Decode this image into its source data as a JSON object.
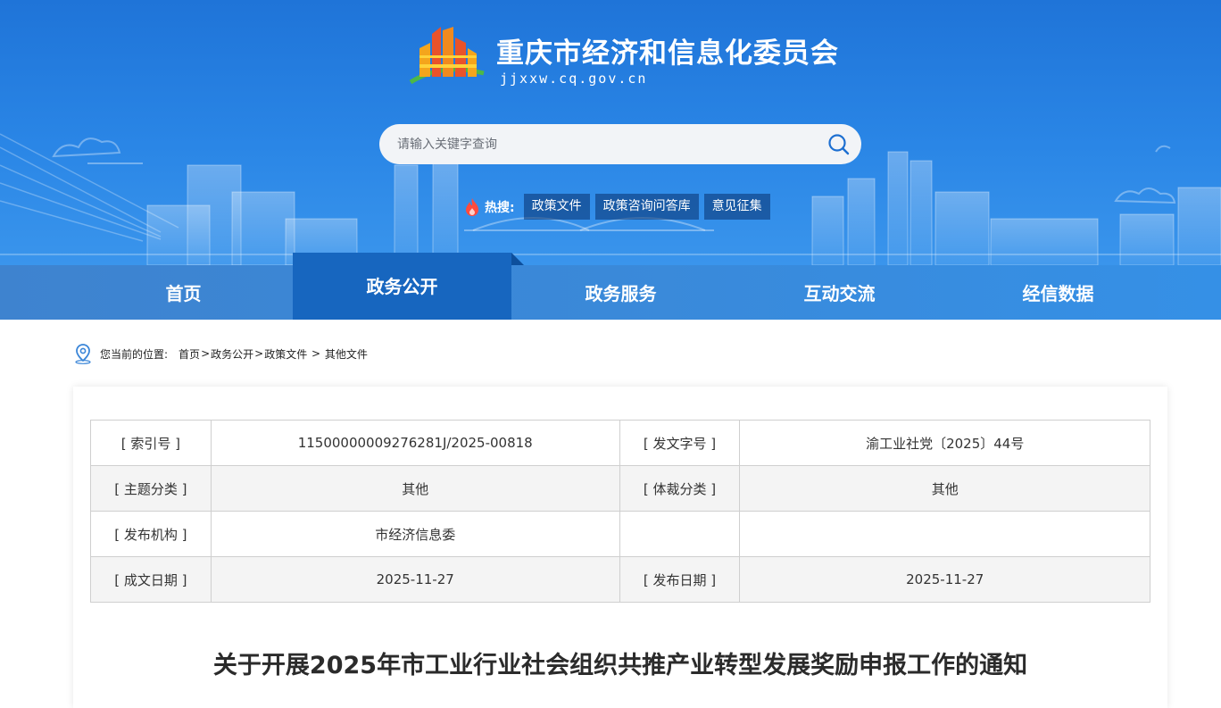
{
  "header": {
    "site_title": "重庆市经济和信息化委员会",
    "site_domain": "jjxxw.cq.gov.cn",
    "search_placeholder": "请输入关键字查询",
    "hot_label": "热搜:",
    "hot_tags": [
      "政策文件",
      "政策咨询问答库",
      "意见征集"
    ]
  },
  "nav": {
    "items": [
      "首页",
      "政务公开",
      "政务服务",
      "互动交流",
      "经信数据"
    ],
    "active": "政务公开"
  },
  "breadcrumb": {
    "prefix": "您当前的位置:",
    "items": [
      "首页",
      "政务公开",
      "政策文件",
      "其他文件"
    ],
    "separators": [
      ">",
      ">",
      " > "
    ]
  },
  "meta_table": {
    "rows": [
      [
        {
          "k": "[ 索引号 ]",
          "v": "11500000009276281J/2025-00818"
        },
        {
          "k": "[ 发文字号 ]",
          "v": "渝工业社党〔2025〕44号"
        }
      ],
      [
        {
          "k": "[ 主题分类 ]",
          "v": "其他"
        },
        {
          "k": "[ 体裁分类 ]",
          "v": "其他"
        }
      ],
      [
        {
          "k": "[ 发布机构 ]",
          "v": "市经济信息委"
        },
        {
          "k": "",
          "v": ""
        }
      ],
      [
        {
          "k": "[ 成文日期 ]",
          "v": "2025-11-27"
        },
        {
          "k": "[ 发布日期 ]",
          "v": "2025-11-27"
        }
      ]
    ]
  },
  "document": {
    "title": "关于开展2025年市工业行业社会组织共推产业转型发展奖励申报工作的通知"
  },
  "colors": {
    "banner_blue": "#2a86e6",
    "nav_active": "#1766bf",
    "hot_tag_bg": "#0b3a78",
    "table_border": "#cfcfcf"
  }
}
